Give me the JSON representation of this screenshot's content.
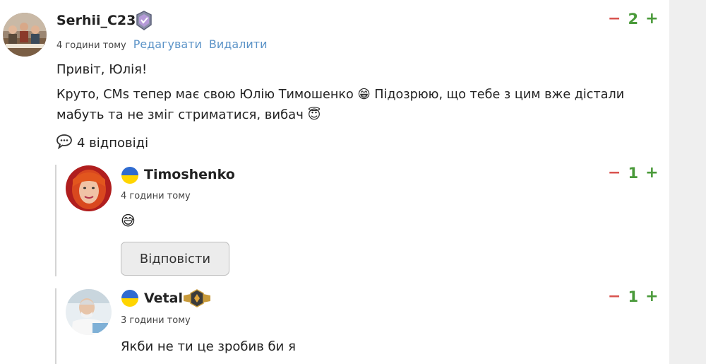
{
  "colors": {
    "minus": "#d9534f",
    "plus": "#4a9a3a",
    "link": "#5b93c7",
    "gutter": "#efefef"
  },
  "comment": {
    "author": "Serhii_C23",
    "time": "4 години тому",
    "edit_label": "Редагувати",
    "delete_label": "Видалити",
    "vote_minus": "−",
    "score": "2",
    "vote_plus": "+",
    "line1": "Привіт, Юлія!",
    "line2": "Круто, CMs тепер має свою Юлію Тимошенко 😁 Підозрюю, що тебе з цим вже дістали",
    "line3": "мабуть та не зміг стриматися, вибач 😇",
    "replies_icon": "speech-bubble-icon",
    "replies_label": "4 відповіді"
  },
  "replies": [
    {
      "author": "Timoshenko",
      "time": "4 години тому",
      "vote_minus": "−",
      "score": "1",
      "vote_plus": "+",
      "text": "😅",
      "reply_button": "Відповісти"
    },
    {
      "author": "Vetal",
      "time": "3 години тому",
      "vote_minus": "−",
      "score": "1",
      "vote_plus": "+",
      "text": "Якби не ти це зробив би я"
    }
  ]
}
